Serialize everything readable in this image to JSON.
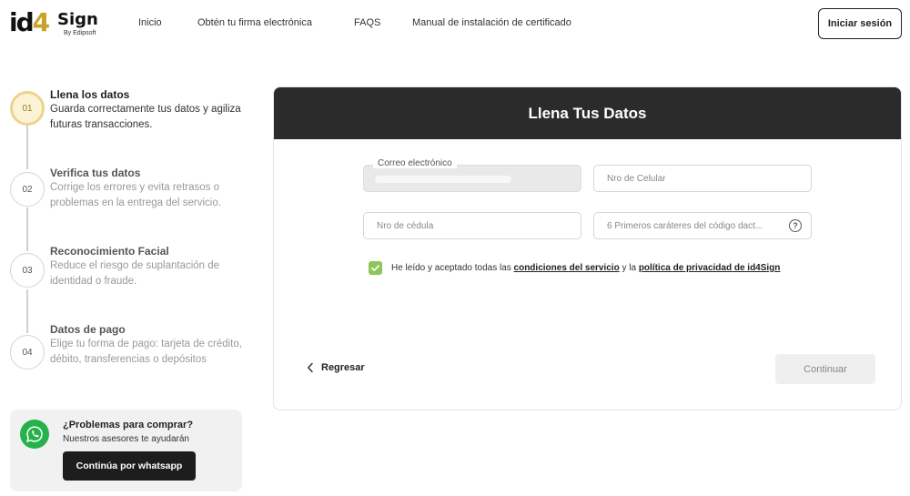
{
  "header": {
    "logo_id": "id",
    "logo_four": "4",
    "logo_sign": "Sign",
    "logo_by": "By Edipsoft",
    "nav": [
      {
        "label": "Inicio"
      },
      {
        "label": "Obtén tu firma electrónica"
      },
      {
        "label": "FAQS"
      },
      {
        "label": "Manual de instalación de certificado"
      }
    ],
    "login_label": "Iniciar sesión"
  },
  "steps": [
    {
      "number": "01",
      "title": "Llena los datos",
      "description": "Guarda correctamente tus datos y agiliza futuras transacciones.",
      "active": true
    },
    {
      "number": "02",
      "title": "Verifica tus datos",
      "description": "Corrige los errores y evita retrasos o problemas en la entrega del servicio.",
      "active": false
    },
    {
      "number": "03",
      "title": "Reconocimiento Facial",
      "description": "Reduce el riesgo de suplantación de identidad o fraude.",
      "active": false
    },
    {
      "number": "04",
      "title": "Datos de pago",
      "description": "Elige tu forma de pago: tarjeta de crédito, débito, transferencias o depósitos",
      "active": false
    }
  ],
  "help": {
    "icon": "whatsapp-icon",
    "title": "¿Problemas para comprar?",
    "subtitle": "Nuestros asesores te ayudarán",
    "button_label": "Continúa por whatsapp"
  },
  "form": {
    "title": "Llena Tus Datos",
    "email_label": "Correo electrónico",
    "phone_placeholder": "Nro de Celular",
    "id_placeholder": "Nro de cédula",
    "code_placeholder": "6 Primeros caráteres del código dact...",
    "terms_prefix": "He leído y aceptado todas las ",
    "terms_link1": "condiciones del servicio",
    "terms_middle": " y la ",
    "terms_link2": "política de privacidad de id4Sign",
    "back_label": "Regresar",
    "continue_label": "Continuar"
  },
  "colors": {
    "accent_gold": "#c9a227",
    "card_header": "#2b2b2b",
    "checkbox_green": "#8dc65a",
    "whatsapp_green": "#25b24a"
  }
}
